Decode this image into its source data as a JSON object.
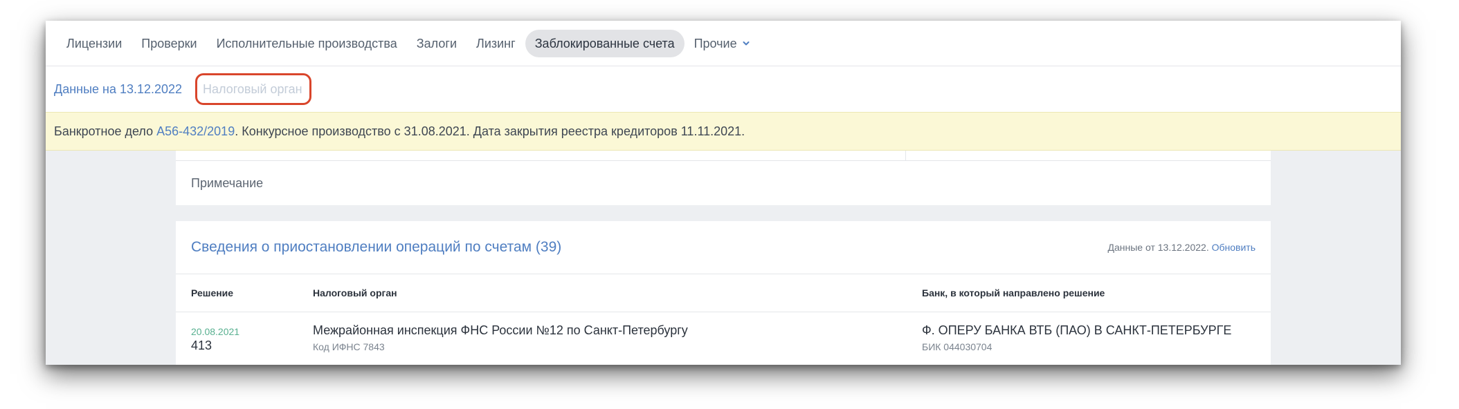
{
  "tabs": [
    {
      "label": "Лицензии"
    },
    {
      "label": "Проверки"
    },
    {
      "label": "Исполнительные производства"
    },
    {
      "label": "Залоги"
    },
    {
      "label": "Лизинг"
    },
    {
      "label": "Заблокированные счета"
    },
    {
      "label": "Прочие"
    }
  ],
  "active_tab": "Заблокированные счета",
  "sub_bar": {
    "data_date": "Данные на 13.12.2022",
    "tax_authority_link": "Налоговый орган"
  },
  "notice": {
    "prefix": "Банкротное дело ",
    "case_number": "А56-432/2019",
    "suffix": ". Конкурсное производство с 31.08.2021. Дата закрытия реестра кредиторов 11.11.2021."
  },
  "note_label": "Примечание",
  "section": {
    "title": "Сведения о приостановлении операций по счетам (39)",
    "meta_prefix": "Данные от 13.12.2022. ",
    "refresh_label": "Обновить"
  },
  "table": {
    "headers": [
      "Решение",
      "Налоговый орган",
      "Банк, в который направлено решение"
    ],
    "rows": [
      {
        "decision_date": "20.08.2021",
        "decision_number": "413",
        "tax_authority": "Межрайонная инспекция ФНС России №12 по Санкт-Петербургу",
        "tax_code": "Код ИФНС 7843",
        "bank": "Ф. ОПЕРУ БАНКА ВТБ (ПАО) В САНКТ-ПЕТЕРБУРГЕ",
        "bik": "БИК 044030704"
      }
    ]
  },
  "colors": {
    "link": "#4f7ec1",
    "highlight_border": "#d9452b",
    "notice_bg": "#fbf8d6",
    "date_green": "#58b090"
  }
}
